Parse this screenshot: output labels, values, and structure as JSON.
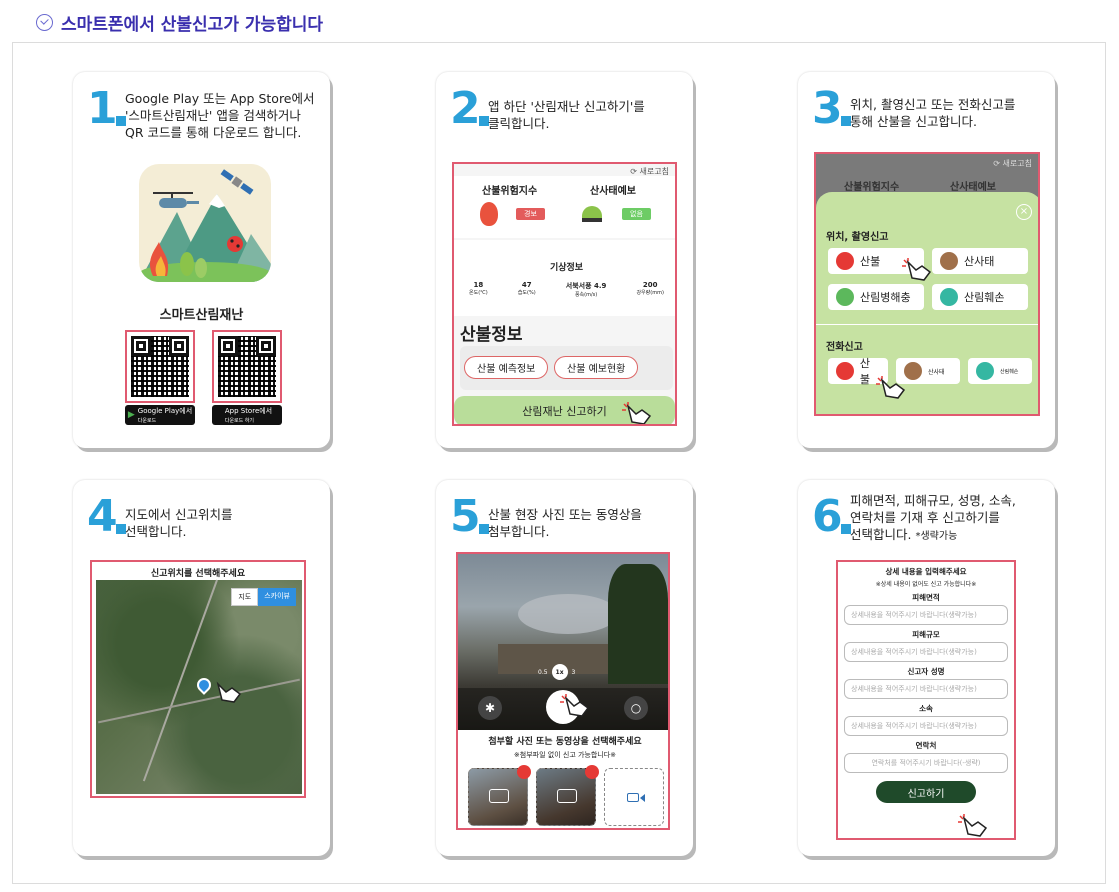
{
  "header": {
    "title": "스마트폰에서 산불신고가 가능합니다"
  },
  "steps": [
    {
      "num": "1",
      "lines": [
        "Google Play 또는 App Store에서",
        "'스마트산림재난' 앱을 검색하거나",
        "QR 코드를 통해 다운로드 합니다."
      ],
      "app_name": "스마트산림재난",
      "google_btn": "Google Play에서",
      "google_sub": "다운로드",
      "apple_btn": "App Store에서",
      "apple_sub": "다운로드 하기"
    },
    {
      "num": "2",
      "lines": [
        "앱 하단 '산림재난 신고하기'를",
        "클릭합니다."
      ],
      "refresh": "새로고침",
      "risk_title": "산불위험지수",
      "risk_tag": "경보",
      "landslide_title": "산사태예보",
      "landslide_tag": "없음",
      "weather_title": "기상정보",
      "weather": [
        {
          "v": "18",
          "l": "온도(℃)"
        },
        {
          "v": "47",
          "l": "습도(%)"
        },
        {
          "v": "서북서풍 4.9",
          "l": "풍속(m/s)"
        },
        {
          "v": "200",
          "l": "강우량(mm)"
        }
      ],
      "fire_info": "산불정보",
      "btn_predict": "산불 예측정보",
      "btn_status": "산불 예보현황",
      "report_btn": "산림재난 신고하기"
    },
    {
      "num": "3",
      "lines": [
        "위치, 촬영신고 또는 전화신고를",
        "통해 산불을 신고합니다."
      ],
      "refresh": "새로고침",
      "bg_left": "산불위험지수",
      "bg_right": "산사태예보",
      "section1": "위치, 촬영신고",
      "opt1": [
        "산불",
        "산사태",
        "산림병해충",
        "산림훼손"
      ],
      "section2": "전화신고",
      "opt2": [
        "산불",
        "산사태",
        "산림훼손"
      ]
    },
    {
      "num": "4",
      "lines": [
        "지도에서 신고위치를",
        "선택합니다."
      ],
      "map_title": "신고위치를 선택해주세요",
      "map_btn": "지도",
      "sky_btn": "스카이뷰"
    },
    {
      "num": "5",
      "lines": [
        "산불 현장 사진 또는 동영상을",
        "첨부합니다."
      ],
      "zoom": [
        "0.5",
        "1x",
        "3"
      ],
      "attach_title": "첨부할 사진 또는 동영상을 선택해주세요",
      "attach_note": "※첨부파일 없이 신고 가능합니다※"
    },
    {
      "num": "6",
      "lines": [
        "피해면적, 피해규모, 성명, 소속,",
        "연락처를 기재 후 신고하기를",
        "선택합니다."
      ],
      "optional": "*생략가능",
      "form_title": "상세 내용을 입력해주세요",
      "form_note": "※상세 내용이 없어도 신고 가능합니다※",
      "fields": [
        {
          "label": "피해면적",
          "ph": "상세내용을 적어주시기 바랍니다(생략가능)"
        },
        {
          "label": "피해규모",
          "ph": "상세내용을 적어주시기 바랍니다(생략가능)"
        },
        {
          "label": "신고자 성명",
          "ph": "상세내용을 적어주시기 바랍니다(생략가능)"
        },
        {
          "label": "소속",
          "ph": "상세내용을 적어주시기 바랍니다(생략가능)"
        },
        {
          "label": "연락처",
          "ph": "연락처를 적어주시기 바랍니다(-생략)"
        }
      ],
      "submit": "신고하기"
    }
  ]
}
